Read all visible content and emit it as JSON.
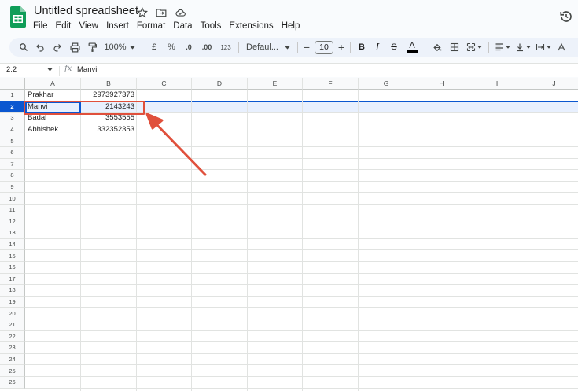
{
  "app": {
    "doc_title": "Untitled spreadsheet",
    "menus": [
      "File",
      "Edit",
      "View",
      "Insert",
      "Format",
      "Data",
      "Tools",
      "Extensions",
      "Help"
    ]
  },
  "toolbar": {
    "zoom": "100%",
    "currency": "£",
    "percent": "%",
    "decrease_decimal": ".0",
    "increase_decimal": ".00",
    "number_format": "123",
    "font": "Defaul...",
    "font_size": "10",
    "minus": "−",
    "plus": "+",
    "bold": "B",
    "italic": "I",
    "strike": "S",
    "text_color": "A"
  },
  "formula_bar": {
    "name_box": "2:2",
    "fx": "fx",
    "value": "Manvi"
  },
  "grid": {
    "columns": [
      "A",
      "B",
      "C",
      "D",
      "E",
      "F",
      "G",
      "H",
      "I",
      "J"
    ],
    "rows": [
      "1",
      "2",
      "3",
      "4",
      "5",
      "6",
      "7",
      "8",
      "9",
      "10",
      "11",
      "12",
      "13",
      "14",
      "15",
      "16",
      "17",
      "18",
      "19",
      "20",
      "21",
      "22",
      "23",
      "24",
      "25",
      "26"
    ],
    "data": [
      {
        "a": "Prakhar",
        "b": "2973927373"
      },
      {
        "a": "Manvi",
        "b": "2143243"
      },
      {
        "a": "Badal",
        "b": "3553555"
      },
      {
        "a": "Abhishek",
        "b": "332352353"
      }
    ],
    "selected_row": "2"
  },
  "colors": {
    "accent": "#0b57d0",
    "annotation": "#e0503c",
    "sheets_green": "#0f9d58"
  }
}
